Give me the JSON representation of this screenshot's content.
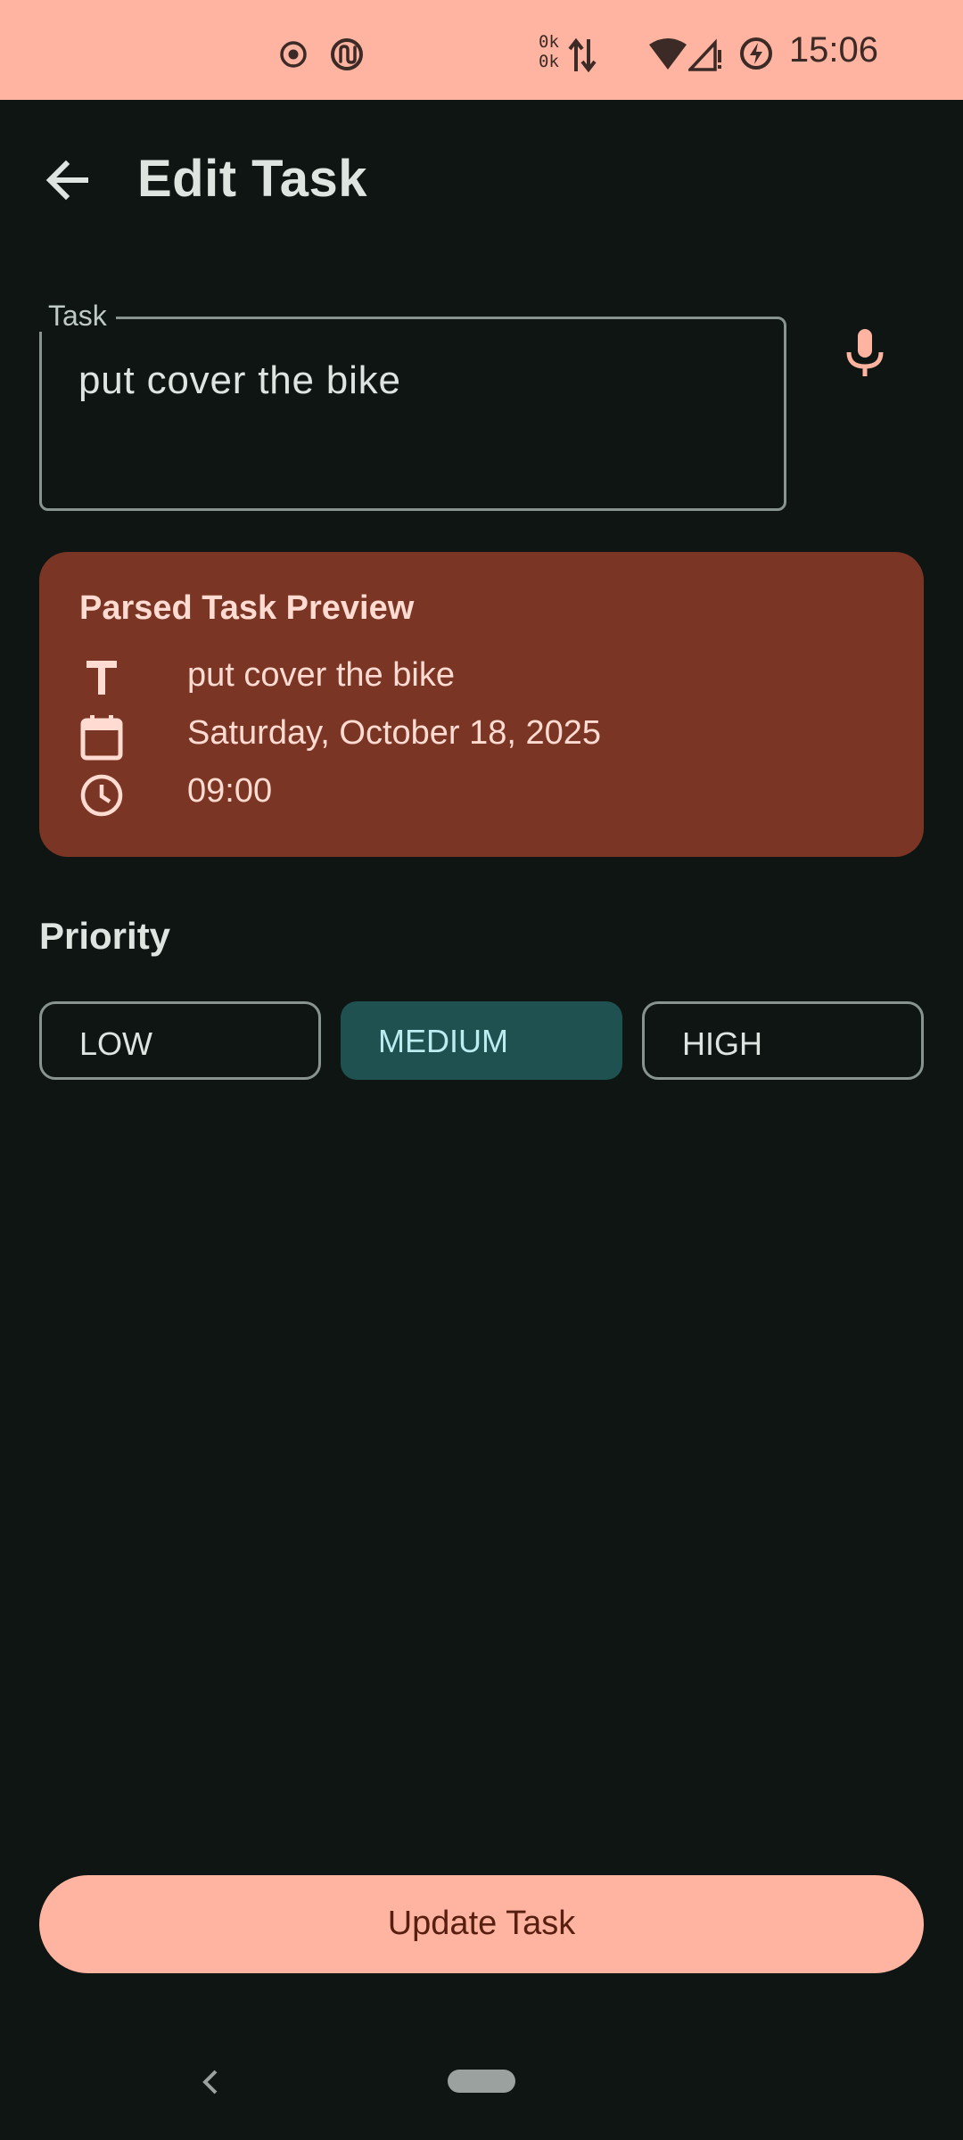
{
  "status_bar": {
    "time": "15:06",
    "net_up": "0k",
    "net_down": "0k",
    "icons": [
      "record-icon",
      "sync-app-icon",
      "data-arrows-icon",
      "wifi-icon",
      "signal-icon",
      "battery-saver-icon"
    ]
  },
  "app_bar": {
    "title": "Edit Task",
    "back_icon": "arrow-back-icon"
  },
  "task_field": {
    "label": "Task",
    "value": "put cover the bike",
    "mic_icon": "microphone-icon"
  },
  "preview": {
    "title": "Parsed Task Preview",
    "rows": [
      {
        "icon": "text-format-icon",
        "text": "put cover the bike"
      },
      {
        "icon": "calendar-icon",
        "text": "Saturday, October 18, 2025"
      },
      {
        "icon": "clock-icon",
        "text": "09:00"
      }
    ]
  },
  "priority": {
    "title": "Priority",
    "options": [
      {
        "label": "LOW",
        "selected": false
      },
      {
        "label": "MEDIUM",
        "selected": true
      },
      {
        "label": "HIGH",
        "selected": false
      }
    ]
  },
  "update_button": {
    "label": "Update Task"
  },
  "colors": {
    "background": "#0e1513",
    "accent": "#ffb4a1",
    "preview_card": "#7a3524",
    "selected_chip": "#1f5151"
  }
}
